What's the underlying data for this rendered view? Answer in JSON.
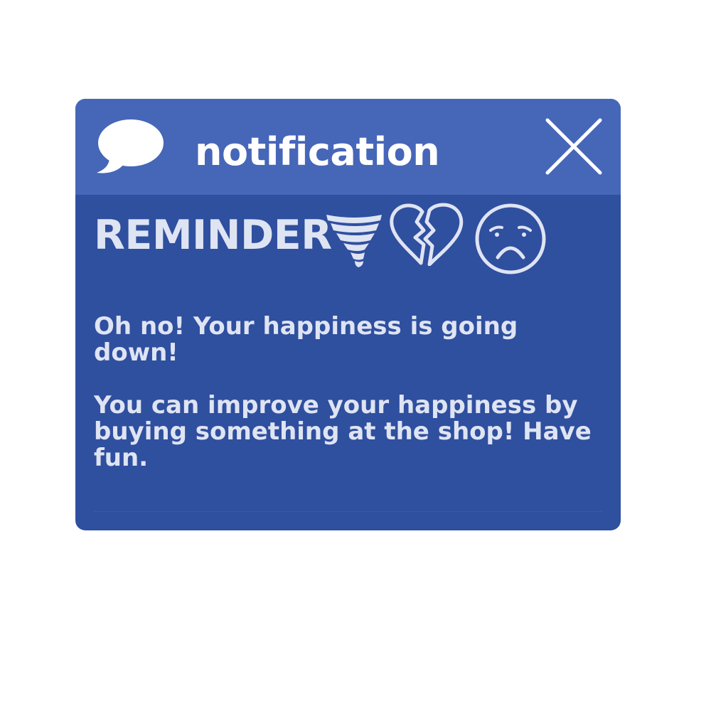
{
  "window": {
    "title": "notification",
    "heading": "REMINDER",
    "message_1": "Oh no! Your happiness is going down!",
    "message_2": "You can improve your happiness by buying something at the shop! Have fun."
  },
  "icons": {
    "title": "speech-bubble-icon",
    "close": "close-icon",
    "heading": [
      "tornado-icon",
      "broken-heart-icon",
      "sad-face-icon"
    ]
  },
  "colors": {
    "titlebar": "#4666b8",
    "body": "#2f4f9f",
    "title_text": "#ffffff",
    "body_text": "#dfe4f3"
  }
}
